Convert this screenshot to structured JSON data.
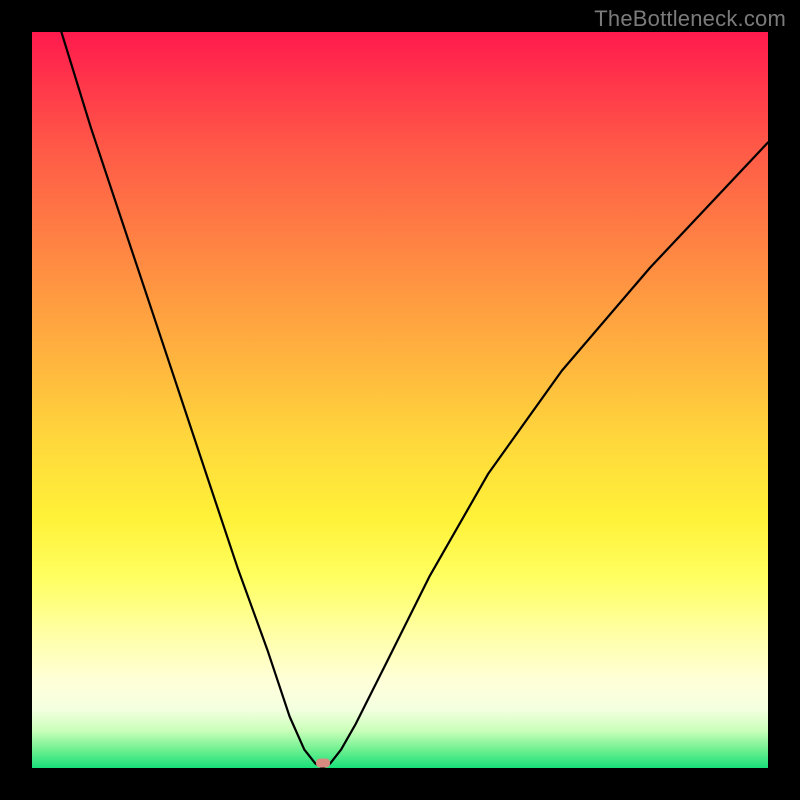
{
  "watermark": {
    "text": "TheBottleneck.com"
  },
  "marker": {
    "x_pct": 39.5,
    "y_pct": 99.3
  },
  "chart_data": {
    "type": "line",
    "title": "",
    "xlabel": "",
    "ylabel": "",
    "xlim": [
      0,
      100
    ],
    "ylim": [
      0,
      100
    ],
    "grid": false,
    "legend": false,
    "series": [
      {
        "name": "bottleneck-curve",
        "x": [
          4,
          8,
          12,
          16,
          20,
          24,
          28,
          32,
          35,
          37,
          38.5,
          39.5,
          40.5,
          42,
          44,
          48,
          54,
          62,
          72,
          84,
          100
        ],
        "values": [
          100,
          87,
          75,
          63,
          51,
          39,
          27,
          16,
          7,
          2.5,
          0.6,
          0,
          0.6,
          2.5,
          6,
          14,
          26,
          40,
          54,
          68,
          85
        ]
      }
    ],
    "annotations": [
      {
        "kind": "marker",
        "x": 39.5,
        "y": 0,
        "color": "#d98a80"
      }
    ],
    "background": {
      "type": "vertical-gradient",
      "stops": [
        {
          "pct": 0,
          "color": "#ff1a4d"
        },
        {
          "pct": 26,
          "color": "#ff7a44"
        },
        {
          "pct": 56,
          "color": "#ffd93b"
        },
        {
          "pct": 82,
          "color": "#ffffa8"
        },
        {
          "pct": 95,
          "color": "#c8ffb8"
        },
        {
          "pct": 100,
          "color": "#18e07a"
        }
      ]
    }
  }
}
